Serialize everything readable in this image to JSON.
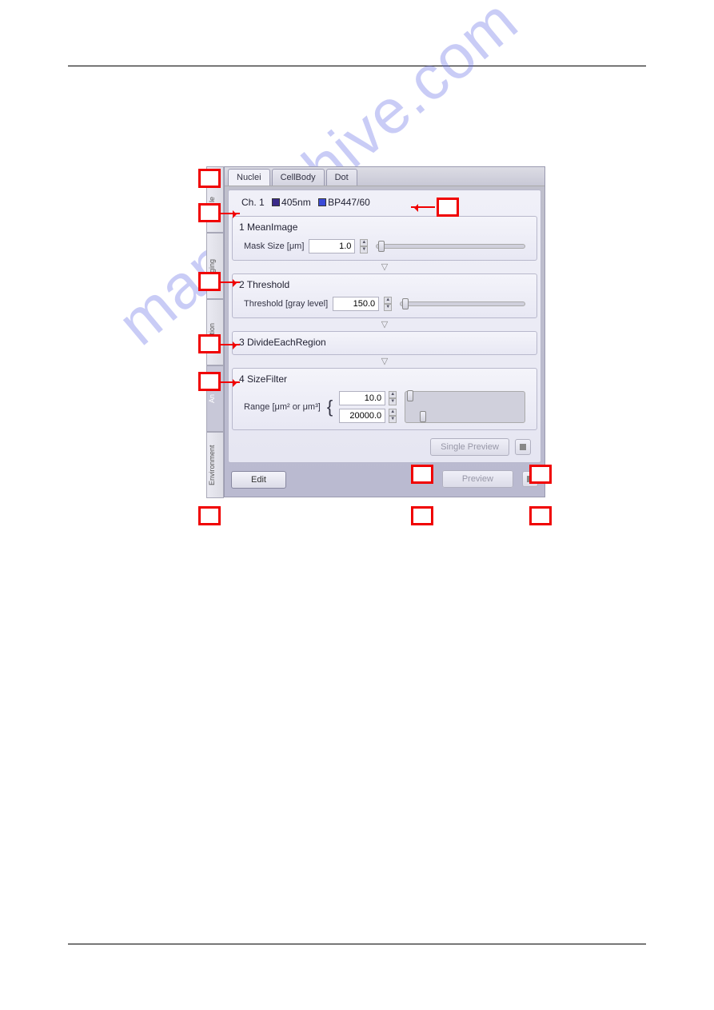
{
  "top_tabs": {
    "t1": "Nuclei",
    "t2": "CellBody",
    "t3": "Dot"
  },
  "side_tabs": {
    "s1": "le",
    "s2": "ging",
    "s3": "cation",
    "s4": "An",
    "s5": "Environment"
  },
  "channel": {
    "prefix": "Ch. 1",
    "laser": "405nm",
    "filter": "BP447/60"
  },
  "step1": {
    "title": "1  MeanImage",
    "param": "Mask Size [μm]",
    "value": "1.0"
  },
  "step2": {
    "title": "2  Threshold",
    "param": "Threshold [gray level]",
    "value": "150.0"
  },
  "step3": {
    "title": "3  DivideEachRegion"
  },
  "step4": {
    "title": "4  SizeFilter",
    "param": "Range [μm² or μm³]",
    "v1": "10.0",
    "v2": "20000.0"
  },
  "buttons": {
    "single_preview": "Single Preview",
    "edit": "Edit",
    "preview": "Preview"
  }
}
